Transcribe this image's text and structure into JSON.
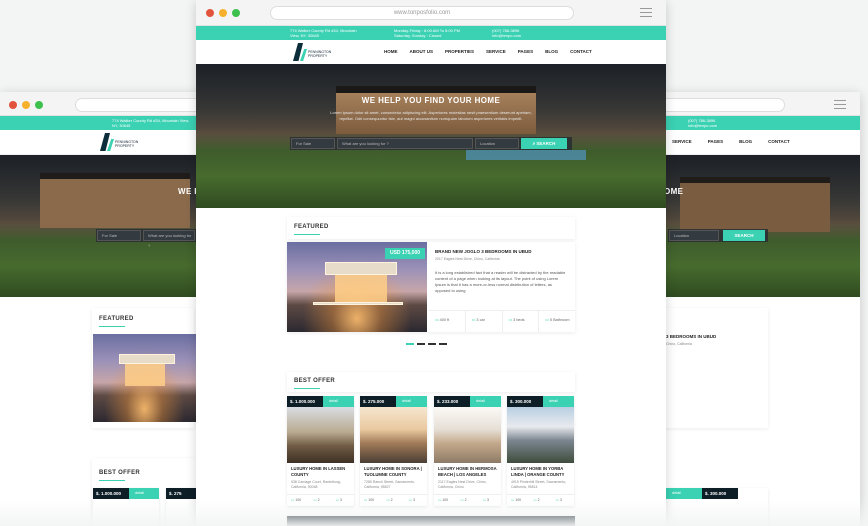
{
  "browser": {
    "url": "www.tonposfolio.com",
    "dot_colors": [
      "#e2543c",
      "#f5b12d",
      "#3ec04f"
    ]
  },
  "topbar": {
    "address": "774 Walker County Rd #34, Mountain View, NY, 30645",
    "hours": "Monday-Friday : 8:00 AM To 5:00 PM\nSaturday, Sunday : Closed",
    "contact": "(007) 786-3896\ninfo@tenpo.com"
  },
  "brand": {
    "name": "PENNINGTON PROPERTY"
  },
  "nav": [
    "HOME",
    "ABOUT US",
    "PROPERTIES",
    "SERVICE",
    "PAGES",
    "BLOG",
    "CONTACT"
  ],
  "hero": {
    "title": "WE HELP YOU FIND YOUR HOME",
    "text": "Lorem ipsum dolor sit amet, consectetur adipiscing elit. Asperiores molestias nesit praesentium deserunt aperiam, repellat. Odit consequuntur iste, aut magni accusantium numquam laborum asperiores veritatis impedit.",
    "search": {
      "type": "For Sale",
      "keyword": "What are you looking for ?",
      "location": "Location",
      "button": "SEARCH"
    }
  },
  "featured": {
    "heading": "FEATURED",
    "price": "USD 175,000",
    "title": "BRAND NEW JOGLO 3 BEDROOMS IN UBUD",
    "address": "2017 Eagles Nest Drive, Chino, California",
    "description": "It is a long established fact that a reader will be distracted by the readable content of a page when looking at its layout. The point of using Lorem Ipsum is that it has a more-or-less normal distribution of letters, as opposed to using",
    "stats": [
      "400 ft",
      "3 car",
      "3 beds",
      "5 Bathroom"
    ]
  },
  "best_offer": {
    "heading": "BEST OFFER",
    "detail_label": "detail",
    "items": [
      {
        "price": "$. 1.000.000",
        "title": "LUXURY HOME IN LASSEN COUNTY",
        "address": "938 Carriage Court, Rantelburg, California, 90048",
        "stats": [
          "100",
          "2",
          "3"
        ]
      },
      {
        "price": "$. 275.000",
        "title": "LUXURY HOME IN SONORA | TUOLUMNE COUNTY",
        "address": "7285 Ranch Street, Sacramento, California, 95827",
        "stats": [
          "100",
          "2",
          "3"
        ]
      },
      {
        "price": "$. 233.000",
        "title": "LUXURY HOME IN HERMOSA BEACH | LOS ANGELES",
        "address": "2117 Eagles Nest Drive, Chino, California, Chino",
        "stats": [
          "100",
          "2",
          "3"
        ]
      },
      {
        "price": "$. 300.000",
        "title": "LUXURY HOME IN YORBA LINDA | ORANGE COUNTY",
        "address": "4915 Pinderhill Street, Sacramento, California, 95814",
        "stats": [
          "100",
          "2",
          "3"
        ]
      }
    ]
  },
  "back_window": {
    "featured_title": "3 BEDROOMS IN UBUD",
    "featured_addr": "Chino, California",
    "offer_price_1": "$. 1.000.000",
    "offer_price_2": "$. 275",
    "offer_price_3": "$. 300.000"
  }
}
